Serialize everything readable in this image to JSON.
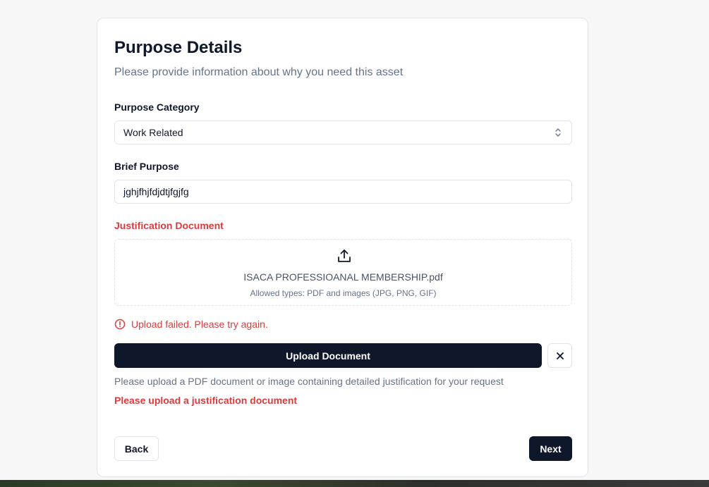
{
  "form": {
    "title": "Purpose Details",
    "subtitle": "Please provide information about why you need this asset",
    "purpose_category": {
      "label": "Purpose Category",
      "value": "Work Related",
      "icon": "chevron-up-down-icon"
    },
    "brief_purpose": {
      "label": "Brief Purpose",
      "value": "jghjfhjfdjdtjfgjfg"
    },
    "justification": {
      "label": "Justification Document",
      "icon": "upload-icon",
      "filename": "ISACA PROFESSIOANAL MEMBERSHIP.pdf",
      "allowed_types": "Allowed types: PDF and images (JPG, PNG, GIF)",
      "error": "Upload failed. Please try again.",
      "error_icon": "alert-circle-icon",
      "upload_button": "Upload Document",
      "clear_icon": "close-icon",
      "help_text": "Please upload a PDF document or image containing detailed justification for your request",
      "required_error": "Please upload a justification document"
    },
    "nav": {
      "back_label": "Back",
      "next_label": "Next"
    }
  },
  "colors": {
    "primary": "#0f172a",
    "error": "#dc3b3b",
    "muted": "#64748b",
    "border": "#e2e4e9"
  }
}
